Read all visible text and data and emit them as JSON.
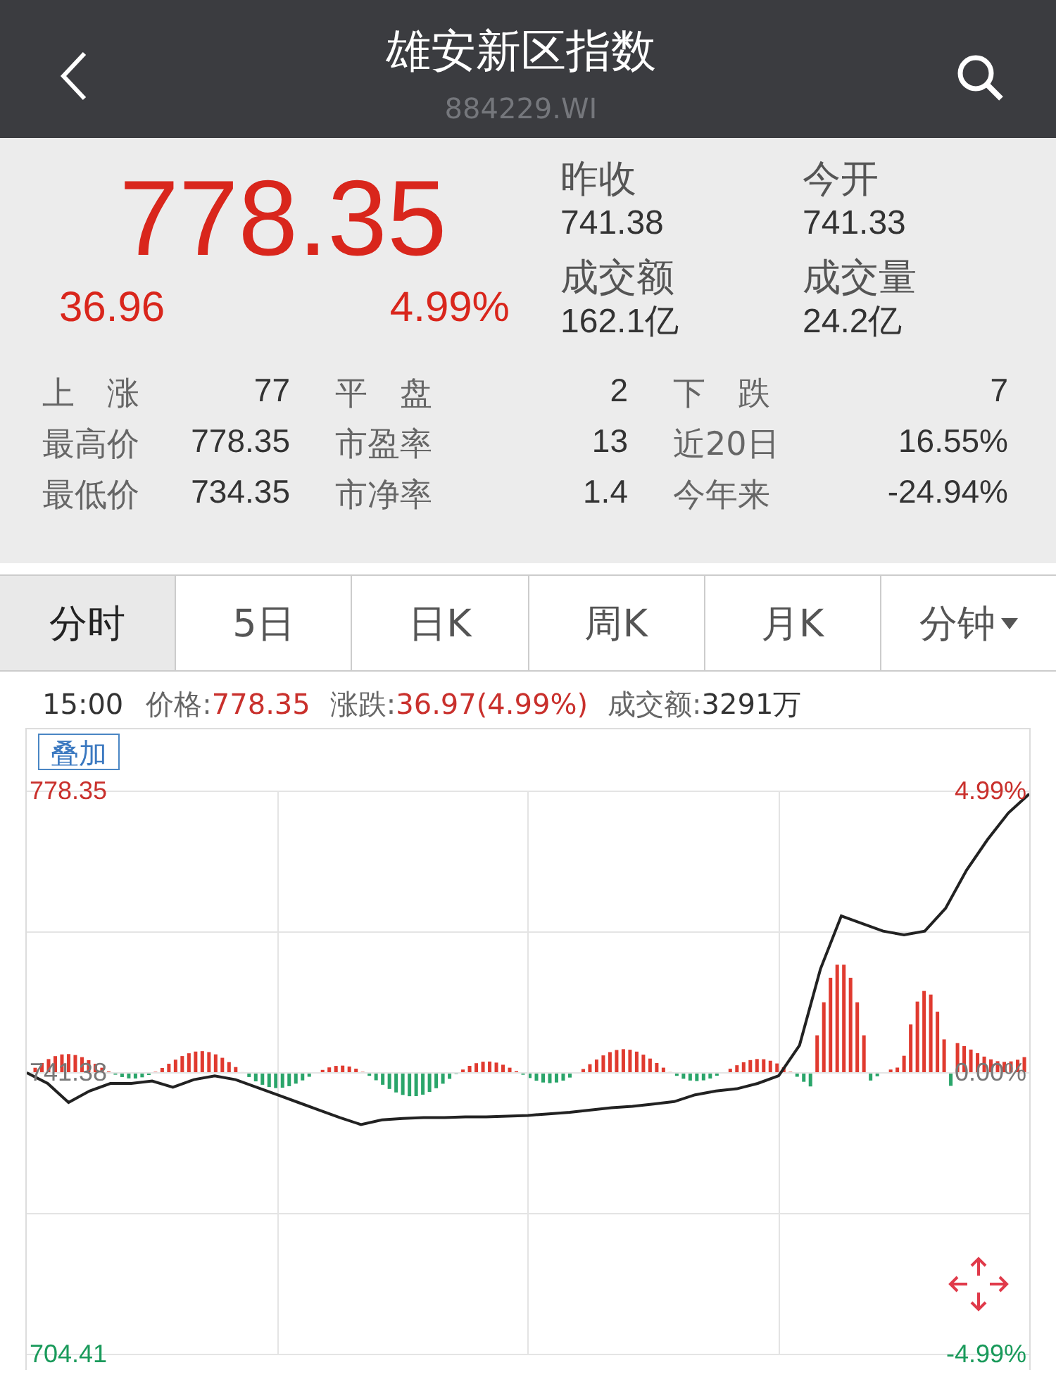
{
  "header": {
    "title": "雄安新区指数",
    "code": "884229.WI"
  },
  "quote": {
    "price": "778.35",
    "change": "36.96",
    "change_pct": "4.99%",
    "fields": [
      {
        "label": "昨收",
        "value": "741.38"
      },
      {
        "label": "今开",
        "value": "741.33"
      },
      {
        "label": "成交额",
        "value": "162.1亿"
      },
      {
        "label": "成交量",
        "value": "24.2亿"
      }
    ],
    "stats": [
      {
        "label": "上　涨",
        "value": "77"
      },
      {
        "label": "平　盘",
        "value": "2"
      },
      {
        "label": "下　跌",
        "value": "7"
      },
      {
        "label": "最高价",
        "value": "778.35"
      },
      {
        "label": "市盈率",
        "value": "13"
      },
      {
        "label": "近20日",
        "value": "16.55%"
      },
      {
        "label": "最低价",
        "value": "734.35"
      },
      {
        "label": "市净率",
        "value": "1.4"
      },
      {
        "label": "今年来",
        "value": "-24.94%"
      }
    ]
  },
  "tabs": [
    {
      "label": "分时",
      "selected": true
    },
    {
      "label": "5日",
      "selected": false
    },
    {
      "label": "日K",
      "selected": false
    },
    {
      "label": "周K",
      "selected": false
    },
    {
      "label": "月K",
      "selected": false
    },
    {
      "label": "分钟",
      "selected": false,
      "dropdown": true
    }
  ],
  "info": {
    "time": "15:00",
    "price_label": "价格:",
    "price": "778.35",
    "change_label": "涨跌:",
    "change": "36.97(4.99%)",
    "amount_label": "成交额:",
    "amount": "3291万"
  },
  "chart": {
    "overlay_button": "叠加",
    "y_high": "778.35",
    "y_mid": "741.38",
    "y_low": "704.41",
    "pct_high": "4.99%",
    "pct_mid": "0.00%",
    "pct_low": "-4.99%",
    "chart_data": {
      "type": "line",
      "grid": true,
      "ylim": [
        704.41,
        778.35
      ],
      "yticks": [
        704.41,
        741.38,
        778.35
      ],
      "series": [
        {
          "color": "#222222",
          "values": [
            741.4,
            740,
            737.5,
            739,
            740,
            740,
            740.3,
            739.5,
            740.5,
            741,
            740.5,
            739.5,
            738.5,
            737.5,
            736.5,
            735.5,
            734.6,
            735.2,
            735.4,
            735.5,
            735.5,
            735.6,
            735.6,
            735.7,
            735.8,
            736,
            736.2,
            736.5,
            736.8,
            737,
            737.3,
            737.6,
            738.5,
            739,
            739.3,
            740,
            741,
            745,
            755,
            762,
            761,
            760,
            759.5,
            760,
            763,
            768,
            772,
            775.5,
            778
          ]
        }
      ]
    }
  }
}
